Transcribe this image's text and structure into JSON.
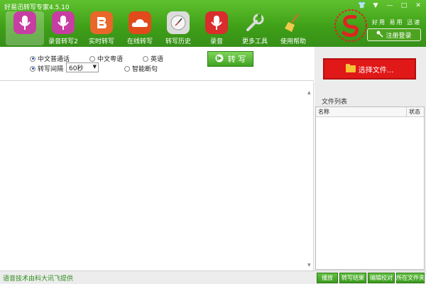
{
  "app": {
    "title": "好易迅转写专家4.5.10",
    "slogan": "好用 易用 迅速",
    "login_label": "注册登录"
  },
  "window": {
    "shirt_icon": "shirt-icon",
    "menu": "▼",
    "minimize": "—",
    "maximize": "□",
    "close": "✕"
  },
  "toolbar": {
    "items": [
      {
        "label": "",
        "icon": "microphone-icon",
        "color": "#c73ea3"
      },
      {
        "label": "录音转写2",
        "icon": "microphone-icon",
        "color": "#c73ea3"
      },
      {
        "label": "实时转写",
        "icon": "blog-icon",
        "color": "#e9672a"
      },
      {
        "label": "在线转写",
        "icon": "cloud-icon",
        "color": "#e14b1c"
      },
      {
        "label": "转写历史",
        "icon": "clock-icon",
        "color": "#dcdcdc"
      },
      {
        "label": "录音",
        "icon": "microphone-icon",
        "color": "#d92c2c"
      },
      {
        "label": "更多工具",
        "icon": "wrench-icon",
        "color": "#d9d9d9"
      },
      {
        "label": "使用帮助",
        "icon": "broom-icon",
        "color": "#e7b23a"
      }
    ]
  },
  "options": {
    "lang_mandarin": "中文普通话",
    "lang_cantonese": "中文粤语",
    "lang_english": "英语",
    "interval_label": "转写间隔",
    "interval_value": "60秒",
    "smart_break": "智能断句",
    "transcribe_label": "转 写"
  },
  "right_panel": {
    "choose_file": "选择文件...",
    "file_list_title": "文件列表",
    "col_name": "名称",
    "col_status": "状态"
  },
  "footer": {
    "credit": "语音技术由科大讯飞提供",
    "buttons": [
      "播放",
      "转写结果",
      "编辑校对",
      "所在文件夹"
    ]
  },
  "colors": {
    "header_green": "#3e9e17",
    "choose_red": "#e01818",
    "credit_green": "#2c8c19"
  }
}
